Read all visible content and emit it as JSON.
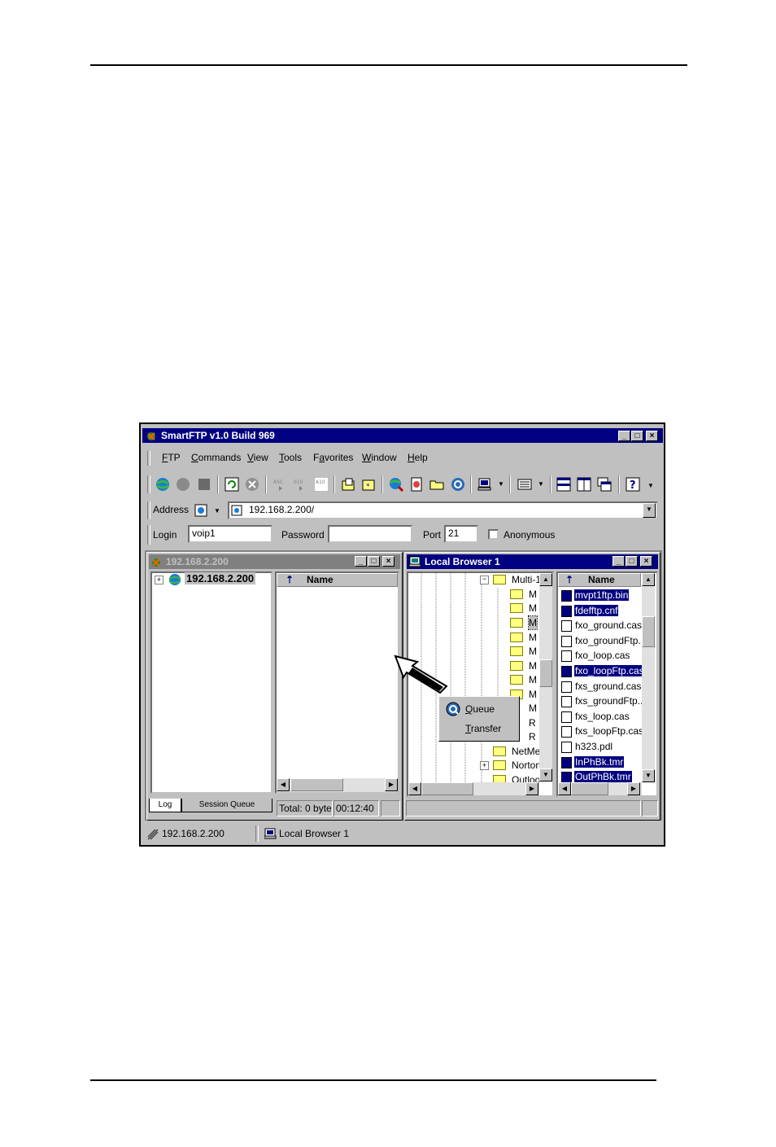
{
  "window": {
    "title": "SmartFTP v1.0 Build 969",
    "menu": [
      {
        "label": "FTP",
        "accel": "F",
        "rest": "TP"
      },
      {
        "label": "Commands",
        "accel": "C",
        "rest": "ommands"
      },
      {
        "label": "View",
        "accel": "V",
        "rest": "iew"
      },
      {
        "label": "Tools",
        "accel": "T",
        "rest": "ools"
      },
      {
        "label": "Favorites",
        "accel": "a",
        "pre": "F",
        "rest": "vorites"
      },
      {
        "label": "Window",
        "accel": "W",
        "rest": "indow"
      },
      {
        "label": "Help",
        "accel": "H",
        "rest": "elp"
      }
    ],
    "address": {
      "label": "Address",
      "value": "192.168.2.200/"
    },
    "login": {
      "label": "Login",
      "value": "voip1"
    },
    "password": {
      "label": "Password",
      "value": ""
    },
    "port": {
      "label": "Port",
      "value": "21"
    },
    "anonymous": {
      "label": "Anonymous",
      "checked": false
    }
  },
  "remote_pane": {
    "title": "192.168.2.200",
    "tree_root": "192.168.2.200",
    "column_header": "Name",
    "tabs": [
      "Log",
      "Session Queue"
    ],
    "status_total": "Total: 0 byte",
    "status_time": "00:12:40"
  },
  "local_pane": {
    "title": "Local Browser 1",
    "column_header": "Name",
    "tree": [
      {
        "label": "Multi-1"
      },
      {
        "label": "M"
      },
      {
        "label": "M"
      },
      {
        "label": "M"
      },
      {
        "label": "M"
      },
      {
        "label": "M"
      },
      {
        "label": "M"
      },
      {
        "label": "M"
      },
      {
        "label": "M"
      },
      {
        "label": "M"
      },
      {
        "label": "R"
      },
      {
        "label": "R"
      },
      {
        "label": "NetMe"
      },
      {
        "label": "Norton"
      },
      {
        "label": "Outloo"
      }
    ],
    "files": [
      {
        "name": "mvpt1ftp.bin",
        "selected": true
      },
      {
        "name": "fdefftp.cnf",
        "selected": true
      },
      {
        "name": "fxo_ground.cas",
        "selected": false
      },
      {
        "name": "fxo_groundFtp..",
        "selected": false
      },
      {
        "name": "fxo_loop.cas",
        "selected": false
      },
      {
        "name": "fxo_loopFtp.cas",
        "selected": true
      },
      {
        "name": "fxs_ground.cas",
        "selected": false
      },
      {
        "name": "fxs_groundFtp..",
        "selected": false
      },
      {
        "name": "fxs_loop.cas",
        "selected": false
      },
      {
        "name": "fxs_loopFtp.cas",
        "selected": false
      },
      {
        "name": "h323.pdl",
        "selected": false
      },
      {
        "name": "InPhBk.tmr",
        "selected": true
      },
      {
        "name": "OutPhBk.tmr",
        "selected": true
      }
    ]
  },
  "context_menu": {
    "items": [
      {
        "label": "Queue",
        "accel": "Q",
        "rest": "ueue",
        "icon": "queue-icon"
      },
      {
        "label": "Transfer",
        "accel": "T",
        "rest": "ransfer"
      }
    ]
  },
  "statusbar": {
    "left": "192.168.2.200",
    "right": "Local Browser 1"
  },
  "colors": {
    "title_active": "#000080",
    "title_inactive": "#808080",
    "face": "#c0c0c0",
    "selection": "#000080"
  }
}
